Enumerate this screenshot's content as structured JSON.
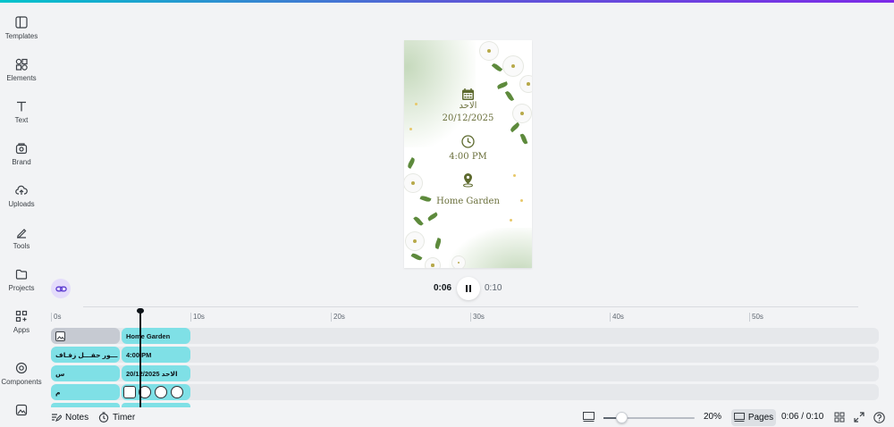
{
  "sidebar": {
    "items": [
      {
        "label": "Templates",
        "icon": "templates-icon"
      },
      {
        "label": "Elements",
        "icon": "elements-icon"
      },
      {
        "label": "Text",
        "icon": "text-icon"
      },
      {
        "label": "Brand",
        "icon": "brand-icon"
      },
      {
        "label": "Uploads",
        "icon": "uploads-icon"
      },
      {
        "label": "Tools",
        "icon": "tools-icon"
      },
      {
        "label": "Projects",
        "icon": "projects-icon"
      },
      {
        "label": "Apps",
        "icon": "apps-icon"
      },
      {
        "label": "Components",
        "icon": "components-icon"
      },
      {
        "label": "",
        "icon": "magic-media-icon"
      }
    ]
  },
  "card": {
    "day": "الاحد",
    "date": "20/12/2025",
    "time": "4:00 PM",
    "location": "Home Garden"
  },
  "playback": {
    "current": "0:06",
    "total": "0:10",
    "state": "playing"
  },
  "timeline": {
    "ruler": [
      "0s",
      "10s",
      "20s",
      "30s",
      "40s",
      "50s"
    ],
    "tracks": [
      {
        "left_label": "",
        "right_label": "Home Garden"
      },
      {
        "left_label": "ـــور حفـــل زفـاف",
        "right_label": "4:00 PM"
      },
      {
        "left_label": "س",
        "right_label": "20/12/2025 الاحد"
      },
      {
        "left_label": "م",
        "right_label": ""
      }
    ]
  },
  "bottombar": {
    "notes": "Notes",
    "timer": "Timer",
    "zoom": "20%",
    "zoom_value": 0.2,
    "pages": "Pages",
    "time": "0:06 / 0:10"
  },
  "colors": {
    "accent": "#7d2ae8",
    "clip": "#7fe0e6",
    "card_text": "#6a6f3b"
  }
}
